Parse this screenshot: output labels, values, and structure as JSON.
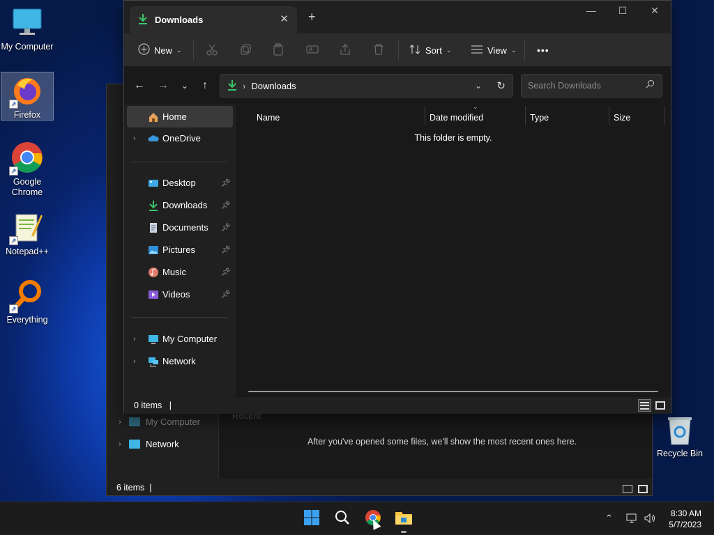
{
  "desktop": {
    "icons": [
      {
        "label": "My Computer"
      },
      {
        "label": "Firefox"
      },
      {
        "label": "Google Chrome"
      },
      {
        "label": "Notepad++"
      },
      {
        "label": "Everything"
      }
    ],
    "recycle_bin": "Recycle Bin"
  },
  "back_window": {
    "nav": {
      "my_computer": "My Computer",
      "network": "Network"
    },
    "recent_heading": "Recent",
    "empty_message": "After you've opened some files, we'll show the most recent ones here.",
    "status": "6 items"
  },
  "window": {
    "tab_title": "Downloads",
    "toolbar": {
      "new_label": "New",
      "sort_label": "Sort",
      "view_label": "View",
      "more_label": "•••"
    },
    "address": {
      "crumb_separator": "›",
      "location": "Downloads"
    },
    "search": {
      "placeholder": "Search Downloads"
    },
    "nav_pane": {
      "home": "Home",
      "onedrive": "OneDrive",
      "desktop": "Desktop",
      "downloads": "Downloads",
      "documents": "Documents",
      "pictures": "Pictures",
      "music": "Music",
      "videos": "Videos",
      "my_computer": "My Computer",
      "network": "Network"
    },
    "columns": {
      "name": "Name",
      "date_modified": "Date modified",
      "type": "Type",
      "size": "Size"
    },
    "empty_message": "This folder is empty.",
    "status": "0 items"
  },
  "taskbar": {
    "time": "8:30 AM",
    "date": "5/7/2023"
  },
  "colors": {
    "accent": "#1e90ff",
    "download_green": "#3cc46a",
    "folder_yellow": "#f4c542"
  }
}
